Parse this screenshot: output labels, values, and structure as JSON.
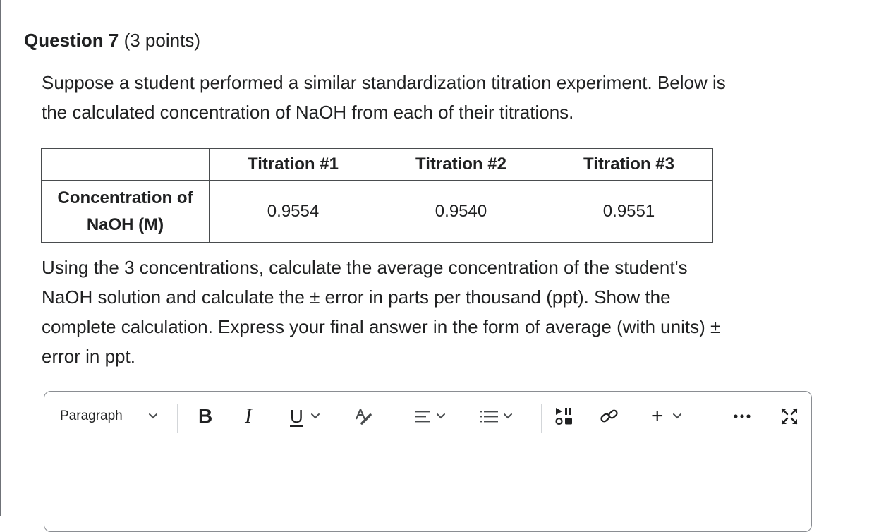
{
  "question": {
    "label": "Question 7",
    "points": "(3 points)",
    "intro": "Suppose a student performed a similar standardization titration experiment. Below is\nthe calculated concentration of NaOH from each of their titrations.",
    "prompt": "Using the 3 concentrations, calculate the average concentration of the student's\nNaOH solution and calculate the ± error in parts per thousand (ppt). Show the\ncomplete calculation. Express your final answer in the form of average (with units) ±\nerror in ppt."
  },
  "table": {
    "headers": [
      "",
      "Titration #1",
      "Titration #2",
      "Titration #3"
    ],
    "row_label": "Concentration of NaOH (M)",
    "row_label_line1": "Concentration of",
    "row_label_line2": "NaOH (M)",
    "values": [
      "0.9554",
      "0.9540",
      "0.9551"
    ]
  },
  "editor": {
    "block_format": "Paragraph",
    "toolbar_icons": [
      "chevron-down-icon",
      "bold-icon",
      "italic-icon",
      "underline-icon",
      "text-color-icon",
      "align-icon",
      "list-icon",
      "media-icon",
      "link-icon",
      "insert-plus-icon",
      "more-icon",
      "fullscreen-icon"
    ],
    "plus_label": "+"
  },
  "colors": {
    "text": "#202122",
    "border": "#494c4e",
    "icon": "#494c4e",
    "divider": "#d3d6d9"
  }
}
